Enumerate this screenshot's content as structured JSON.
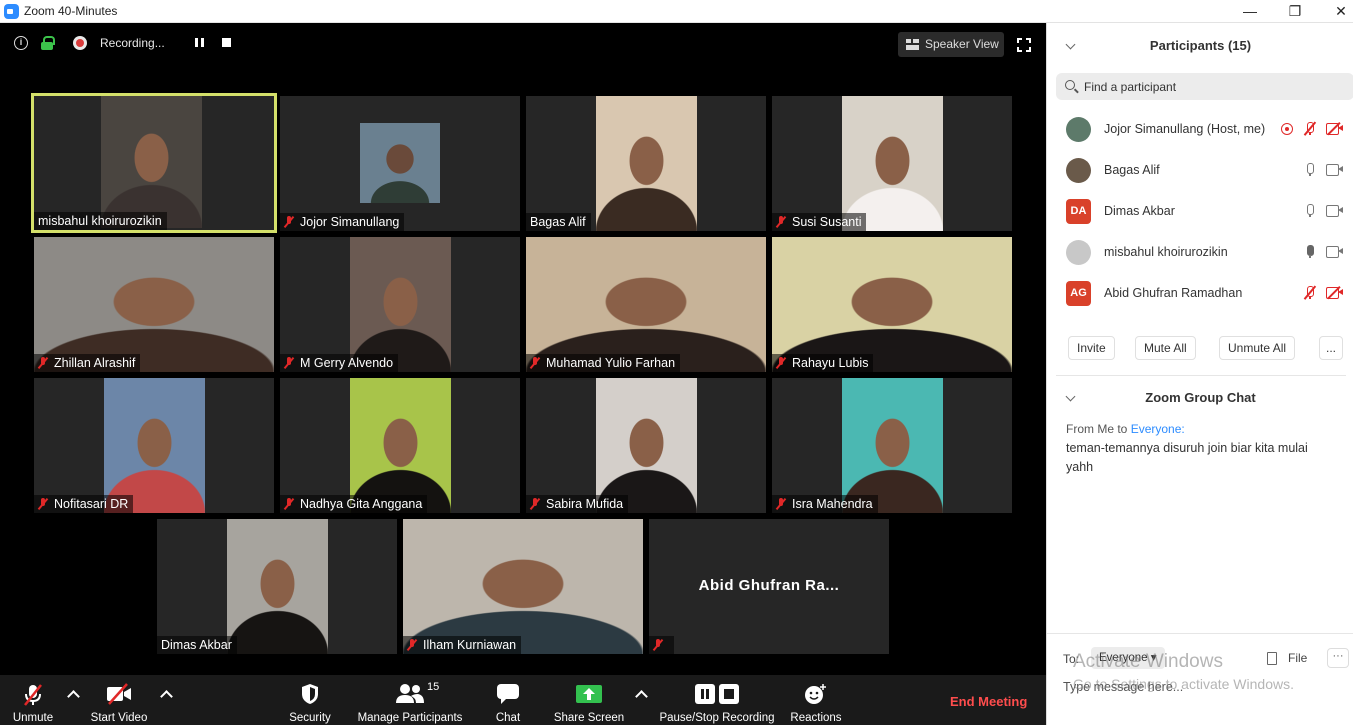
{
  "window": {
    "title": "Zoom 40-Minutes",
    "minimize": "—",
    "maximize": "❐",
    "close": "✕"
  },
  "meeting_top": {
    "recording_label": "Recording...",
    "speaker_view_label": "Speaker View"
  },
  "tiles": [
    {
      "name": "misbahul khoirurozikin",
      "muted": false,
      "active": true,
      "bg": "#4a4540",
      "face": "#3a3230"
    },
    {
      "name": "Jojor Simanullang",
      "muted": true,
      "active": false,
      "thumb": true,
      "bg": "#6a8090",
      "face": "#2f3d36"
    },
    {
      "name": "Bagas Alif",
      "muted": false,
      "active": false,
      "bg": "#d9c7b0",
      "face": "#3a2b22"
    },
    {
      "name": "Susi Susanti",
      "muted": true,
      "active": false,
      "bg": "#d8d2c8",
      "face": "#f4f0ee"
    },
    {
      "name": "Zhillan Alrashif",
      "muted": true,
      "active": false,
      "bg": "#8d8a86",
      "face": "#3e2c24",
      "wide": true
    },
    {
      "name": "M Gerry Alvendo",
      "muted": true,
      "active": false,
      "bg": "#6b5a52",
      "face": "#1f1a18"
    },
    {
      "name": "Muhamad Yulio Farhan",
      "muted": true,
      "active": false,
      "bg": "#c7b398",
      "face": "#2a201c",
      "wide": true
    },
    {
      "name": "Rahayu Lubis",
      "muted": true,
      "active": false,
      "bg": "#d9d2a4",
      "face": "#1a1616",
      "wide": true
    },
    {
      "name": "Nofitasari DR",
      "muted": true,
      "active": false,
      "bg": "#6c86a8",
      "face": "#c24848"
    },
    {
      "name": "Nadhya Gita Anggana",
      "muted": true,
      "active": false,
      "bg": "#a8c44a",
      "face": "#141210"
    },
    {
      "name": "Sabira Mufida",
      "muted": true,
      "active": false,
      "bg": "#d4cfca",
      "face": "#1a1717"
    },
    {
      "name": "Isra Mahendra",
      "muted": true,
      "active": false,
      "bg": "#4bb8b2",
      "face": "#3a2720"
    },
    {
      "name": "Dimas Akbar",
      "muted": false,
      "active": false,
      "bg": "#a7a49e",
      "face": "#161412"
    },
    {
      "name": "Ilham Kurniawan",
      "muted": true,
      "active": false,
      "bg": "#bdb6ac",
      "face": "#2c3a42",
      "wide": true
    },
    {
      "name": "",
      "bigname": "Abid Ghufran Ra...",
      "muted": true,
      "active": false,
      "novideo": true
    }
  ],
  "toolbar": {
    "unmute": "Unmute",
    "start_video": "Start Video",
    "security": "Security",
    "manage_participants": "Manage Participants",
    "participant_count": "15",
    "chat": "Chat",
    "share_screen": "Share Screen",
    "pause_stop_recording": "Pause/Stop Recording",
    "reactions": "Reactions",
    "end_meeting": "End Meeting"
  },
  "participants_panel": {
    "title": "Participants (15)",
    "search_placeholder": "Find a participant",
    "list": [
      {
        "name": "Jojor Simanullang (Host, me)",
        "avatar_text": "",
        "avatar_color": "#5d7a6a",
        "recording": true,
        "mic": "muted",
        "cam": "off"
      },
      {
        "name": "Bagas Alif",
        "avatar_text": "",
        "avatar_color": "#6a5a4a",
        "recording": false,
        "mic": "on",
        "cam": "on"
      },
      {
        "name": "Dimas Akbar",
        "avatar_text": "DA",
        "avatar_color": "#d9412a",
        "recording": false,
        "mic": "on",
        "cam": "on"
      },
      {
        "name": "misbahul khoirurozikin",
        "avatar_text": "",
        "avatar_color": "#c8c8c8",
        "recording": false,
        "mic": "active",
        "cam": "on"
      },
      {
        "name": "Abid Ghufran Ramadhan",
        "avatar_text": "AG",
        "avatar_color": "#d9412a",
        "recording": false,
        "mic": "muted",
        "cam": "off"
      }
    ],
    "invite": "Invite",
    "mute_all": "Mute All",
    "unmute_all": "Unmute All",
    "more": "..."
  },
  "chat_panel": {
    "title": "Zoom Group Chat",
    "from_label": "From Me to",
    "to_name": "Everyone:",
    "message": "teman-temannya disuruh join biar kita mulai yahh",
    "to_label": "To:",
    "to_value": "Everyone",
    "file_label": "File",
    "more": "···",
    "input_placeholder": "Type message here...",
    "watermark_title": "Activate Windows",
    "watermark_sub": "Go to Settings to activate Windows."
  }
}
